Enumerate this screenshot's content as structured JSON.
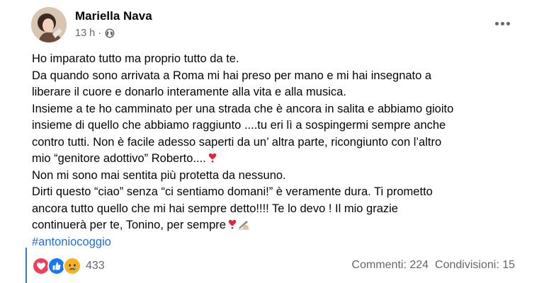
{
  "post": {
    "author": "Mariella Nava",
    "time": "13 h",
    "separator": "·",
    "privacy_icon": "globe-icon",
    "more_icon": "more-options-icon",
    "lines": [
      "Ho imparato tutto ma proprio tutto da te.",
      "Da quando sono arrivata a Roma mi hai preso per mano e mi hai insegnato a",
      "liberare il cuore e donarlo interamente alla vita e alla musica.",
      "Insieme a te ho camminato per una strada che è ancora in salita e abbiamo gioito",
      "insieme di quello che abbiamo raggiunto ....tu eri lì a sospingermi sempre anche",
      "contro tutti. Non è facile adesso saperti da un’ altra parte, ricongiunto con l’altro",
      "mio “genitore adottivo” Roberto....",
      "Non mi sono mai sentita più protetta da nessuno.",
      "Dirti questo “ciao” senza “ci sentiamo domani!” è veramente dura. Ti prometto",
      "ancora tutto quello che mi hai sempre detto!!!! Te lo devo ! Il mio grazie",
      "continuerà per te, Tonino, per sempre"
    ],
    "hashtag": "#antoniocoggio",
    "emojis": [
      "heavy-heart-exclamation-icon",
      "writing-hand-icon"
    ]
  },
  "reactions": {
    "icons": [
      "love-reaction-icon",
      "like-reaction-icon",
      "sad-reaction-icon"
    ],
    "count": "433"
  },
  "stats": {
    "comments": "Commenti: 224",
    "shares": "Condivisioni: 15"
  },
  "colors": {
    "text": "#050505",
    "secondary": "#65676b",
    "link": "#216fdb",
    "like": "#1877f2",
    "love": "#f33e58",
    "sad": "#f7b125"
  }
}
